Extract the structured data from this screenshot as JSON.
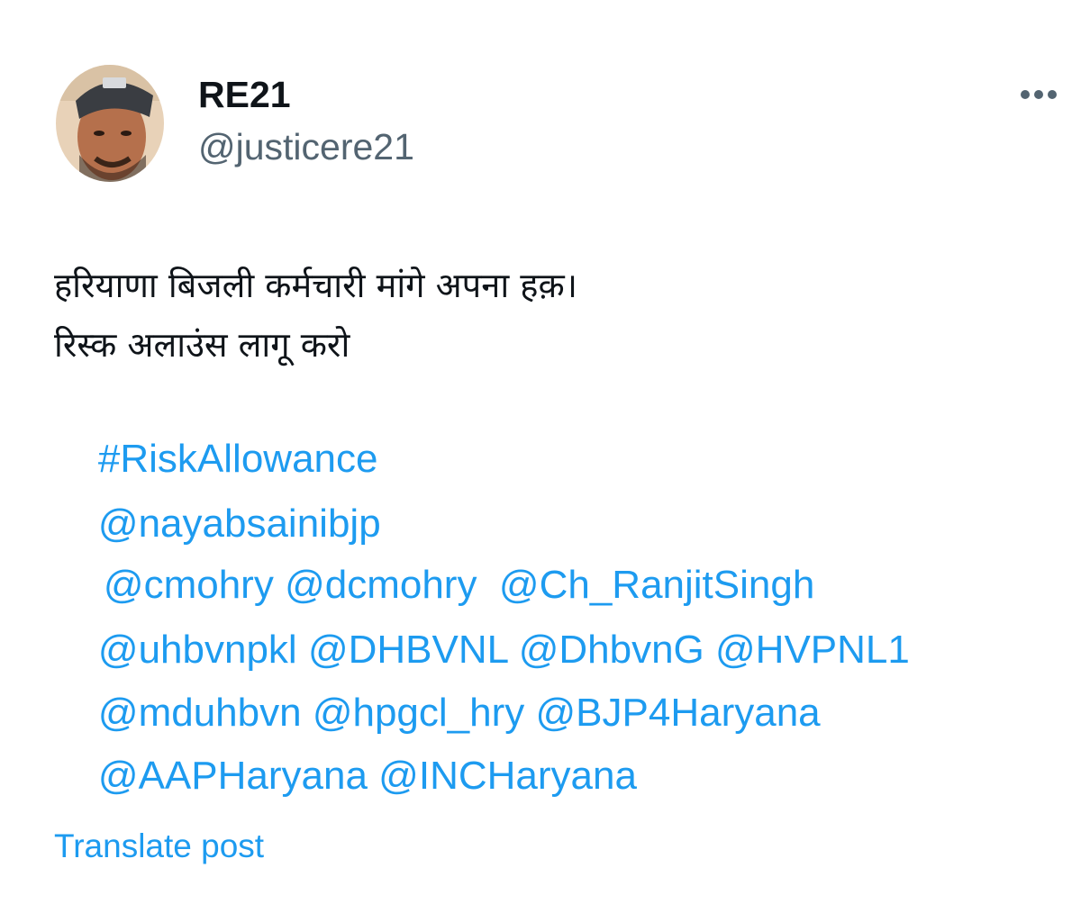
{
  "author": {
    "display_name": "RE21",
    "handle": "@justicere21"
  },
  "post": {
    "text_lines": [
      "हरियाणा बिजली कर्मचारी मांगे अपना हक़।",
      "रिस्क अलाउंस लागू करो"
    ],
    "hashtag": "#RiskAllowance",
    "mention_lines": [
      [
        "@nayabsainibjp"
      ],
      [
        "@cmohry",
        "@dcmohry",
        "@Ch_RanjitSingh"
      ],
      [
        "@uhbvnpkl",
        "@DHBVNL",
        "@DhbvnG",
        "@HVPNL1"
      ],
      [
        "@mduhbvn",
        "@hpgcl_hry",
        "@BJP4Haryana"
      ],
      [
        "@AAPHaryana",
        "@INCHaryana"
      ]
    ]
  },
  "translate_label": "Translate post",
  "icons": {
    "more": "more-options-icon",
    "avatar": "profile-avatar"
  },
  "colors": {
    "link": "#1d9bf0",
    "text": "#0f1419",
    "secondary": "#536471"
  }
}
